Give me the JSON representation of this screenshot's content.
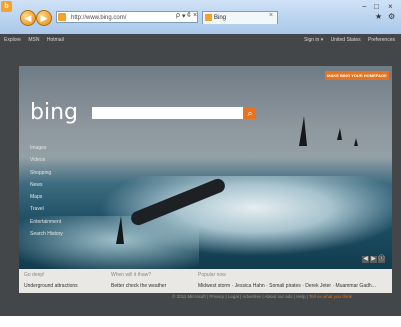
{
  "browser": {
    "address_text": "http://www.bing.com/",
    "address_controls": [
      "ρ",
      "▾",
      "¢",
      "×"
    ],
    "tab_title": "Bing",
    "tab_close": "×",
    "back_glyph": "◀",
    "forward_glyph": "▶",
    "window_controls": [
      "−",
      "□",
      "×"
    ],
    "tools_icons": [
      "star-icon",
      "gear-icon"
    ],
    "favorites_glyph": "★",
    "gear_glyph": "⚙"
  },
  "bing": {
    "top_links": [
      "Explore",
      "MSN",
      "Hotmail"
    ],
    "top_right": [
      "Sign in ▾",
      "United States",
      "Preferences"
    ],
    "logo": "bing",
    "homepage_badge": "MAKE BING YOUR HOMEPAGE",
    "search": {
      "placeholder": "",
      "button_glyph": "⌕"
    },
    "sidenav": [
      "Images",
      "Videos",
      "Shopping",
      "News",
      "Maps",
      "Travel",
      "Entertainment",
      "Search History"
    ],
    "hero_controls": [
      "◀",
      "▶",
      "ⓘ"
    ]
  },
  "info": {
    "go_deep": {
      "heading": "Go deep!",
      "text": "Underground attractions"
    },
    "whats_there": {
      "heading": "When will it thaw?",
      "text": "Better check the weather"
    },
    "popular": {
      "heading": "Popular now",
      "text": "Midwest storm · Jessica Hahn · Somali pirates · Derek Jeter · Muammar Gadh..."
    }
  },
  "footer": {
    "links": [
      "© 2011 Microsoft",
      "Privacy",
      "Legal",
      "Advertise",
      "About our ads",
      "Help"
    ],
    "last": "Tell us what you think"
  }
}
